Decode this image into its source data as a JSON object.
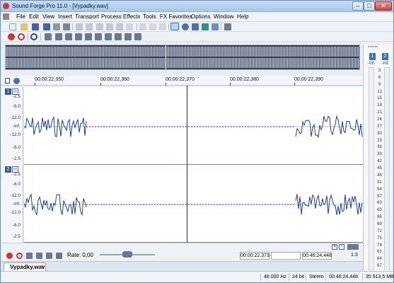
{
  "window": {
    "title": "Sound Forge Pro 11.0 - [Vypadky.wav]",
    "minimize_glyph": "–",
    "maximize_glyph": "□",
    "close_glyph": "✕"
  },
  "menu": [
    "File",
    "Edit",
    "View",
    "Insert",
    "Transport",
    "Process",
    "Effects",
    "Tools",
    "FX Favorites",
    "Options",
    "Window",
    "Help"
  ],
  "timeline": {
    "labels": [
      "00:00:22,350",
      "00:00:22,360",
      "00:00:22,370",
      "00:00:22,380",
      "00:00:22,390"
    ]
  },
  "channel1": {
    "badge": "1",
    "toggle": "–",
    "scale": [
      "-2.5",
      "-6.0",
      "-12.0",
      "-Inf.",
      "-12.0",
      "-6.0",
      "-2.5"
    ]
  },
  "channel2": {
    "badge": "2",
    "toggle": "–",
    "scale": [
      "-2.5",
      "-6.0",
      "-12.0",
      "-Inf.",
      "-12.0",
      "-6.0",
      "-2.5"
    ]
  },
  "meters": {
    "top": "******",
    "ch1": "1",
    "ch2": "2",
    "peak1": "-Inf.",
    "peak2": "-Inf.",
    "scale": [
      "3",
      "6",
      "9",
      "12",
      "15",
      "18",
      "21",
      "24",
      "27",
      "30",
      "33",
      "36",
      "39",
      "42",
      "45",
      "48",
      "51",
      "54",
      "57",
      "60",
      "63",
      "66",
      "69",
      "72",
      "75",
      "78",
      "81",
      "84",
      "87"
    ]
  },
  "transport": {
    "rate_label": "Rate: 0,00",
    "cursor_time": "00:00:22,373",
    "sel_end": "",
    "length": "00:46:24,448",
    "zoom": "1:3"
  },
  "tab": {
    "label": "Vypadky.wav",
    "close": "×"
  },
  "status": {
    "sample_rate": "48 000 Hz",
    "bit_depth": "24 bit",
    "channels": "Stereo",
    "length": "00:46:24,448",
    "disk": "35 913,5 MB"
  },
  "colors": {
    "waveform": "#1f3e95",
    "titlebar": "#b7d0ec",
    "accent": "#2e5da8"
  }
}
